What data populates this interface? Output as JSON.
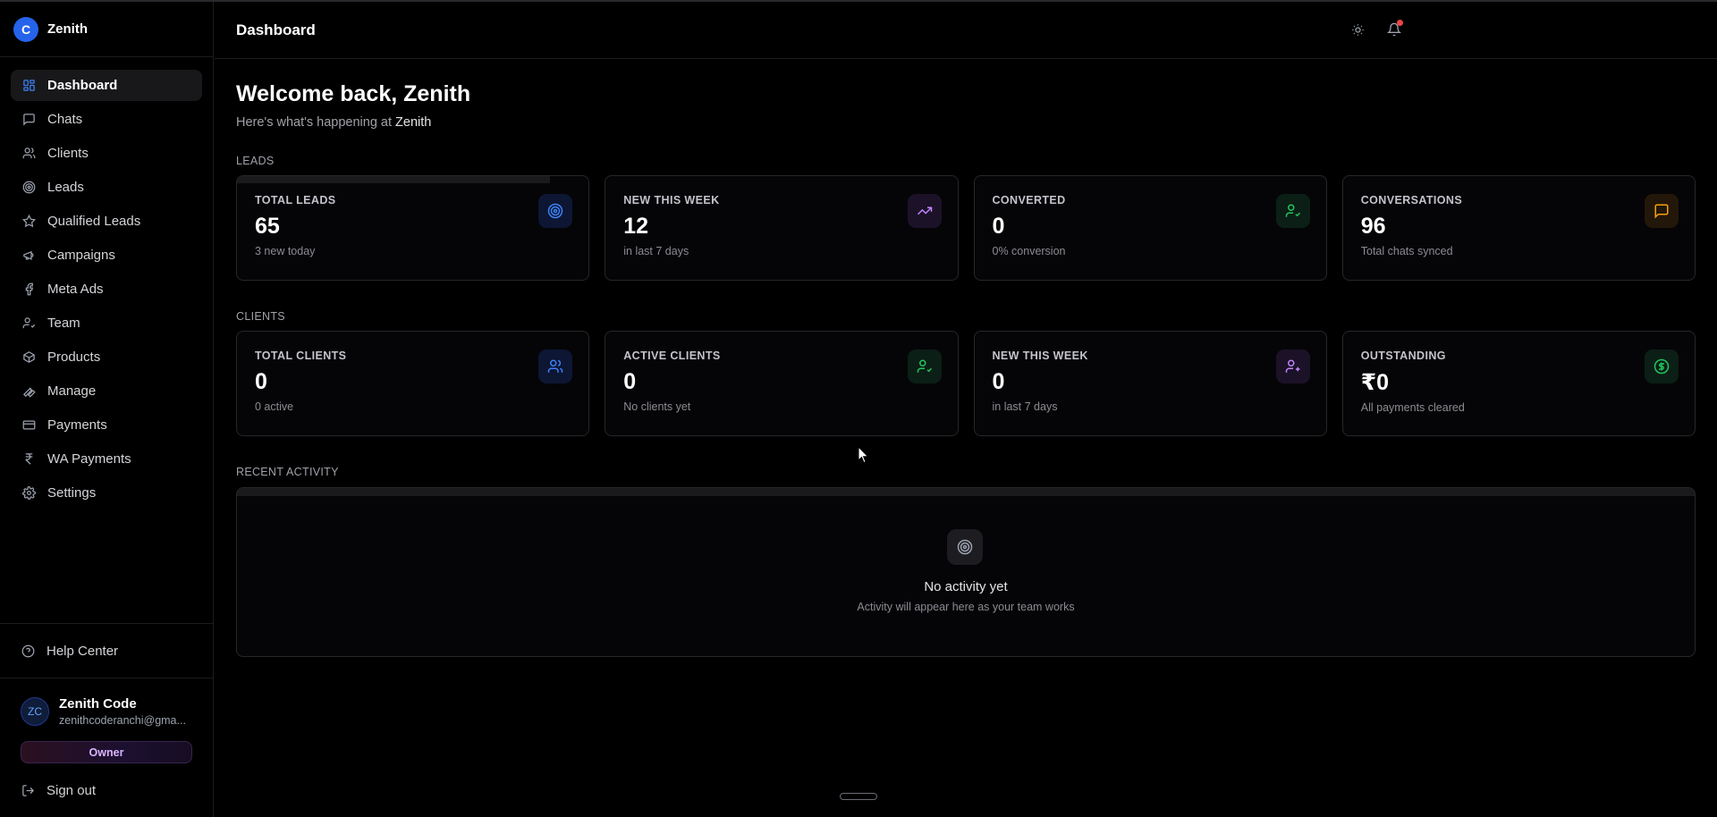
{
  "brand": {
    "logo_letter": "C",
    "name": "Zenith"
  },
  "sidebar": {
    "items": [
      {
        "label": "Dashboard",
        "icon": "grid-icon",
        "active": true
      },
      {
        "label": "Chats",
        "icon": "message-square-icon"
      },
      {
        "label": "Clients",
        "icon": "users-icon"
      },
      {
        "label": "Leads",
        "icon": "target-icon"
      },
      {
        "label": "Qualified Leads",
        "icon": "star-icon"
      },
      {
        "label": "Campaigns",
        "icon": "megaphone-icon"
      },
      {
        "label": "Meta Ads",
        "icon": "facebook-icon"
      },
      {
        "label": "Team",
        "icon": "user-check-icon"
      },
      {
        "label": "Products",
        "icon": "package-icon"
      },
      {
        "label": "Manage",
        "icon": "wrench-icon"
      },
      {
        "label": "Payments",
        "icon": "credit-card-icon"
      },
      {
        "label": "WA Payments",
        "icon": "rupee-icon"
      },
      {
        "label": "Settings",
        "icon": "gear-icon"
      }
    ],
    "help_label": "Help Center",
    "user": {
      "initials": "ZC",
      "name": "Zenith Code",
      "email": "zenithcoderanchi@gma..."
    },
    "role_badge": "Owner",
    "signout_label": "Sign out"
  },
  "header": {
    "title": "Dashboard",
    "notification_dot": true
  },
  "main": {
    "welcome": "Welcome back, Zenith",
    "subtitle_prefix": "Here's what's happening at",
    "subtitle_org": "Zenith",
    "leads_section": "LEADS",
    "leads_cards": [
      {
        "label": "TOTAL LEADS",
        "value": "65",
        "sub": "3 new today",
        "icon": "target-icon",
        "color": "#3b82f6"
      },
      {
        "label": "NEW THIS WEEK",
        "value": "12",
        "sub": "in last 7 days",
        "icon": "trending-up-icon",
        "color": "#a855f7"
      },
      {
        "label": "CONVERTED",
        "value": "0",
        "sub": "0% conversion",
        "icon": "user-check-icon",
        "color": "#22c55e"
      },
      {
        "label": "CONVERSATIONS",
        "value": "96",
        "sub": "Total chats synced",
        "icon": "message-square-icon",
        "color": "#f59e0b"
      }
    ],
    "clients_section": "CLIENTS",
    "clients_cards": [
      {
        "label": "TOTAL CLIENTS",
        "value": "0",
        "sub": "0 active",
        "icon": "users-icon",
        "color": "#3b82f6"
      },
      {
        "label": "ACTIVE CLIENTS",
        "value": "0",
        "sub": "No clients yet",
        "icon": "user-check-icon",
        "color": "#22c55e"
      },
      {
        "label": "NEW THIS WEEK",
        "value": "0",
        "sub": "in last 7 days",
        "icon": "user-plus-icon",
        "color": "#a855f7"
      },
      {
        "label": "OUTSTANDING",
        "value": "₹0",
        "sub": "All payments cleared",
        "icon": "dollar-circle-icon",
        "color": "#22c55e"
      }
    ],
    "activity_section": "RECENT ACTIVITY",
    "activity": {
      "empty_title": "No activity yet",
      "empty_sub": "Activity will appear here as your team works"
    }
  }
}
